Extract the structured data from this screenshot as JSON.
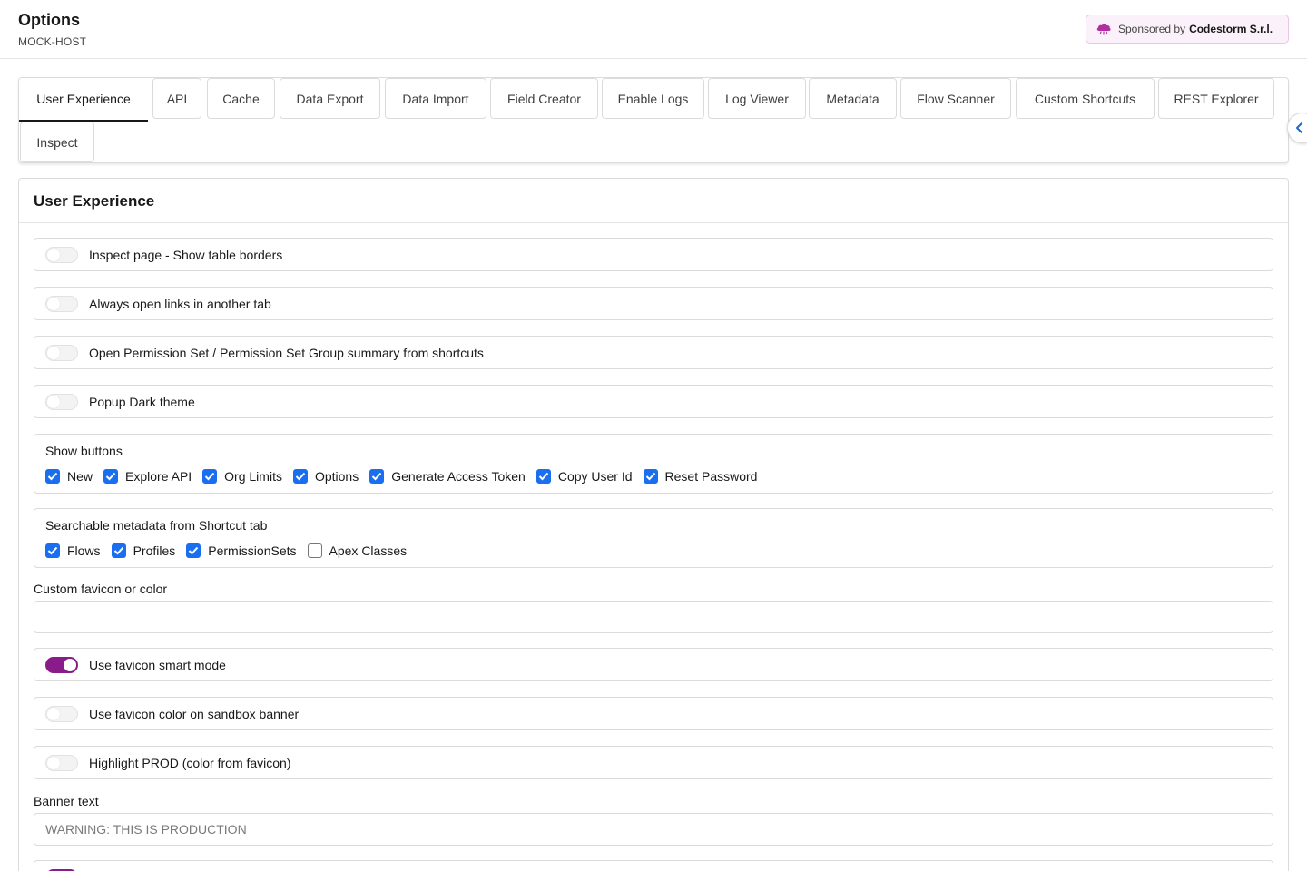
{
  "header": {
    "title": "Options",
    "host": "MOCK-HOST",
    "sponsor_prefix": "Sponsored by",
    "sponsor_name": "Codestorm S.r.l.",
    "sponsor_icon": "cloud-icon"
  },
  "tabs": [
    {
      "label": "User Experience",
      "active": true
    },
    {
      "label": "API"
    },
    {
      "label": "Cache"
    },
    {
      "label": "Data Export"
    },
    {
      "label": "Data Import"
    },
    {
      "label": "Field Creator"
    },
    {
      "label": "Enable Logs"
    },
    {
      "label": "Log Viewer"
    },
    {
      "label": "Metadata"
    },
    {
      "label": "Flow Scanner"
    },
    {
      "label": "Custom Shortcuts"
    },
    {
      "label": "REST Explorer"
    },
    {
      "label": "Inspect"
    }
  ],
  "side_toggle_icon": "chevron-left-icon",
  "section": {
    "title": "User Experience",
    "toggles": [
      {
        "label": "Inspect page - Show table borders",
        "on": false
      },
      {
        "label": "Always open links in another tab",
        "on": false
      },
      {
        "label": "Open Permission Set / Permission Set Group summary from shortcuts",
        "on": false
      },
      {
        "label": "Popup Dark theme",
        "on": false
      }
    ],
    "show_buttons": {
      "title": "Show buttons",
      "items": [
        {
          "label": "New",
          "checked": true
        },
        {
          "label": "Explore API",
          "checked": true
        },
        {
          "label": "Org Limits",
          "checked": true
        },
        {
          "label": "Options",
          "checked": true
        },
        {
          "label": "Generate Access Token",
          "checked": true
        },
        {
          "label": "Copy User Id",
          "checked": true
        },
        {
          "label": "Reset Password",
          "checked": true
        }
      ]
    },
    "searchable_metadata": {
      "title": "Searchable metadata from Shortcut tab",
      "items": [
        {
          "label": "Flows",
          "checked": true
        },
        {
          "label": "Profiles",
          "checked": true
        },
        {
          "label": "PermissionSets",
          "checked": true
        },
        {
          "label": "Apex Classes",
          "checked": false
        }
      ]
    },
    "custom_favicon": {
      "label": "Custom favicon or color",
      "value": "",
      "placeholder": ""
    },
    "favicon_toggles": [
      {
        "label": "Use favicon smart mode",
        "on": true
      },
      {
        "label": "Use favicon color on sandbox banner",
        "on": false
      },
      {
        "label": "Highlight PROD (color from favicon)",
        "on": false
      }
    ],
    "banner_text": {
      "label": "Banner text",
      "value": "",
      "placeholder": "WARNING: THIS IS PRODUCTION"
    },
    "partial_toggle": {
      "on": true
    }
  },
  "colors": {
    "accent": "#8a1b8a",
    "checkbox": "#1a6ef0",
    "border": "#dddbda"
  }
}
